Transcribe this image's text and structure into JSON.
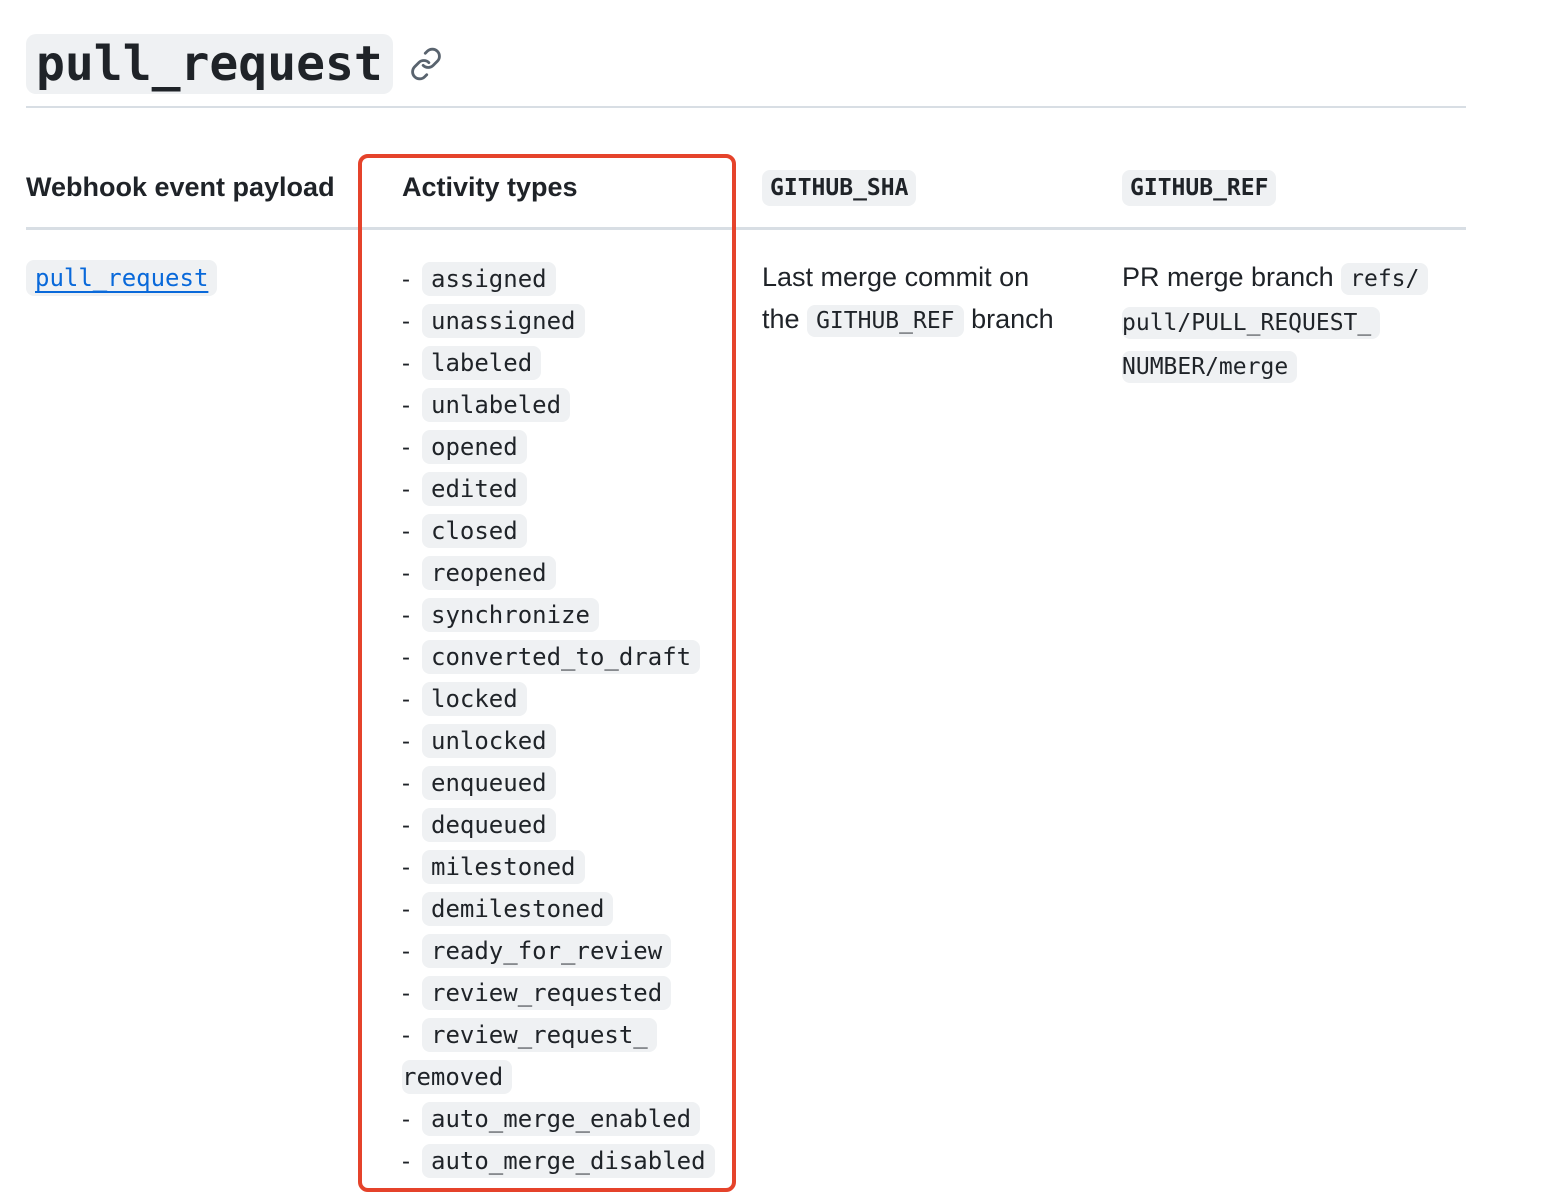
{
  "heading": {
    "title": "pull_request",
    "anchor_icon": "link-icon"
  },
  "table": {
    "headers": {
      "payload": "Webhook event payload",
      "activity": "Activity types",
      "sha": "GITHUB_SHA",
      "ref": "GITHUB_REF"
    },
    "row": {
      "payload_link": "pull_request",
      "activity_types": [
        "assigned",
        "unassigned",
        "labeled",
        "unlabeled",
        "opened",
        "edited",
        "closed",
        "reopened",
        "synchronize",
        "converted_to_draft",
        "locked",
        "unlocked",
        "enqueued",
        "dequeued",
        "milestoned",
        "demilestoned",
        "ready_for_review",
        "review_requested",
        "review_request_removed",
        "auto_merge_enabled",
        "auto_merge_disabled"
      ],
      "activity_dash": "-",
      "sha": {
        "text_1": "Last merge commit on",
        "text_2": "the",
        "code": "GITHUB_REF",
        "text_3": "branch"
      },
      "ref": {
        "text": "PR merge branch",
        "code": "refs/pull/PULL_REQUEST_NUMBER/merge"
      }
    }
  },
  "colors": {
    "highlight_border": "#e5432b",
    "link": "#0969da",
    "code_bg": "#eff1f3"
  }
}
